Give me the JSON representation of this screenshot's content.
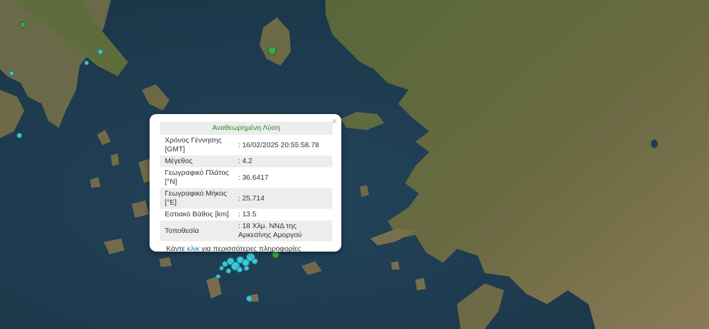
{
  "popup": {
    "header": "Αναθεωρημένη Λύση",
    "close_glyph": "×",
    "rows": [
      {
        "label": "Χρόνος Γέννησης [GMT]",
        "value": ": 16/02/2025 20:55:58.78"
      },
      {
        "label": "Μέγεθος",
        "value": ": 4.2"
      },
      {
        "label": "Γεωγραφικό Πλάτος [°N]",
        "value": ": 36.6417"
      },
      {
        "label": "Γεωγραφικό Μήκος [°E]",
        "value": ": 25.714"
      },
      {
        "label": "Εστιακό Βάθος [km]",
        "value": ": 13.5"
      },
      {
        "label": "Τοποθεσία",
        "value": ": 18 Χλμ. ΝΝΔ της Αρκεσίνης Αμοργού"
      }
    ],
    "more_before": "Κάντε",
    "more_link": "κλικ",
    "more_after": "για περισσότερες πληροφορίες"
  },
  "colors": {
    "sea": "#1f3e52",
    "land": "#5d6b3a",
    "land_dry": "#8f7f5c",
    "marker_cyan": "#3cc8d8",
    "marker_green": "#3aa845",
    "popup_header": "#2a8a2a",
    "link": "#2b7bb9"
  },
  "map": {
    "markers": [
      {
        "color": "cyan"
      },
      {
        "color": "cyan"
      },
      {
        "color": "cyan"
      },
      {
        "color": "cyan"
      },
      {
        "color": "green"
      },
      {
        "color": "green"
      }
    ]
  }
}
